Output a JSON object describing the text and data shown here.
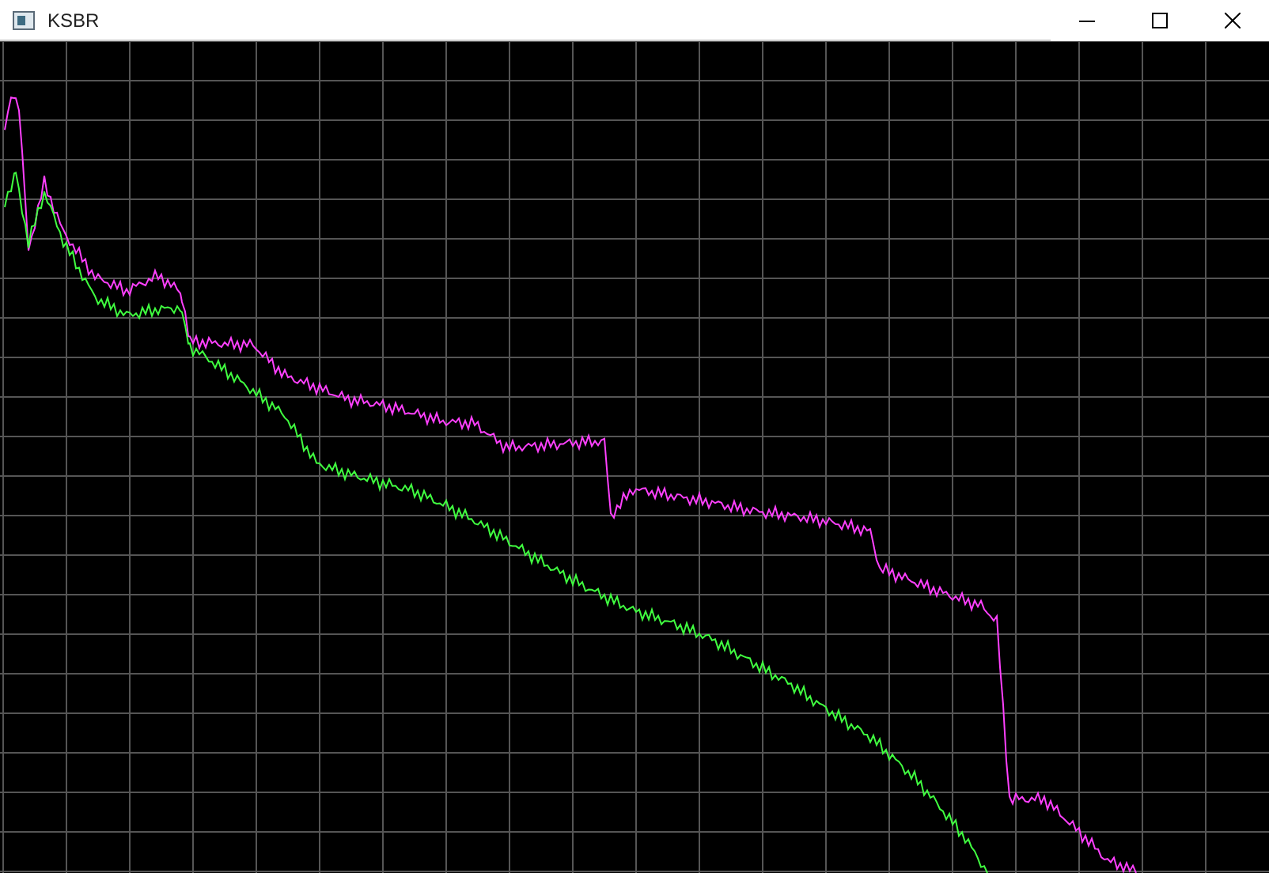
{
  "window": {
    "title": "KSBR"
  },
  "plot": {
    "series": [
      {
        "color": "#ff40ff"
      },
      {
        "color": "#40ff40"
      }
    ]
  }
}
